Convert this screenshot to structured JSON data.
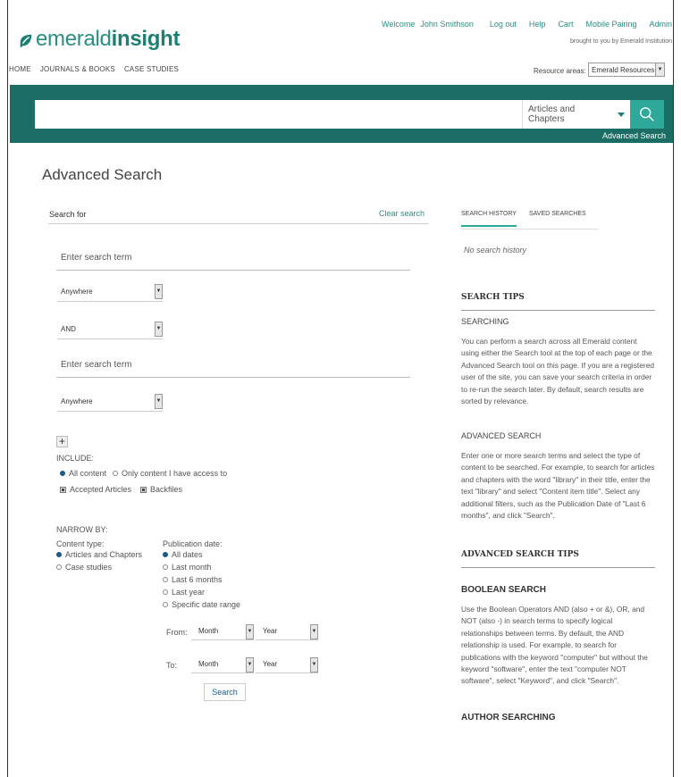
{
  "header": {
    "logo_plain": "emerald",
    "logo_bold": "insight",
    "top_links": [
      "Welcome",
      "John Smithson",
      "Log out",
      "Help",
      "Cart",
      "Mobile Pairing",
      "Admin"
    ],
    "brought": "brought to you by Emerald Institution",
    "main_nav": [
      "HOME",
      "JOURNALS & BOOKS",
      "CASE STUDIES"
    ],
    "resource_label": "Resource areas:",
    "resource_value": "Emerald Resources"
  },
  "search_band": {
    "scope": "Articles and Chapters",
    "advanced_link": "Advanced Search"
  },
  "form": {
    "title": "Advanced Search",
    "search_for": "Search for",
    "clear": "Clear search",
    "term1_placeholder": "Enter search term",
    "field1": "Anywhere",
    "operator": "AND",
    "term2_placeholder": "Enter search term",
    "field2": "Anywhere",
    "include_label": "INCLUDE:",
    "include_all": "All content",
    "include_access": "Only content I have access to",
    "accepted": "Accepted Articles",
    "backfiles": "Backfiles",
    "narrow_label": "NARROW BY:",
    "content_type_label": "Content type:",
    "content_types": [
      "Articles and Chapters",
      "Case studies"
    ],
    "pub_date_label": "Publication date:",
    "pub_dates": [
      "All dates",
      "Last month",
      "Last 6 months",
      "Last year",
      "Specific date range"
    ],
    "from_label": "From:",
    "to_label": "To:",
    "month": "Month",
    "year": "Year",
    "search_button": "Search"
  },
  "sidebar": {
    "tab_history": "SEARCH HISTORY",
    "tab_saved": "SAVED SEARCHES",
    "no_history": "No search history",
    "tips_head": "SEARCH TIPS",
    "searching_head": "SEARCHING",
    "searching_text": "You can perform a search across all Emerald content using either the Search tool at the top of each page or the Advanced Search tool on this page. If you are a registered user of the site, you can save your search criteria in order to re-run the search later. By default, search results are sorted by relevance.",
    "advanced_head": "ADVANCED SEARCH",
    "advanced_text": "Enter one or more search terms and select the type of content to be searched. For example, to search for articles and chapters with the word \"library\" in their title, enter the text \"library\" and select \"Content item title\". Select any additional filters, such as the Publication Date of \"Last 6 months\", and click \"Search\".",
    "adv_tips_head": "ADVANCED SEARCH TIPS",
    "boolean_head": "BOOLEAN SEARCH",
    "boolean_text": "Use the Boolean Operators AND (also + or &), OR, and NOT (also -) in search terms to specify logical relationships between terms. By default, the AND relationship is used. For example, to search for publications with the keyword \"computer\" but without the keyword \"software\", enter the text \"computer NOT software\", select \"Keyword\", and click \"Search\".",
    "author_head": "AUTHOR SEARCHING"
  },
  "colors": {
    "brand": "#1c7f73",
    "band": "#1b6d65",
    "search_button": "#2ea898"
  }
}
